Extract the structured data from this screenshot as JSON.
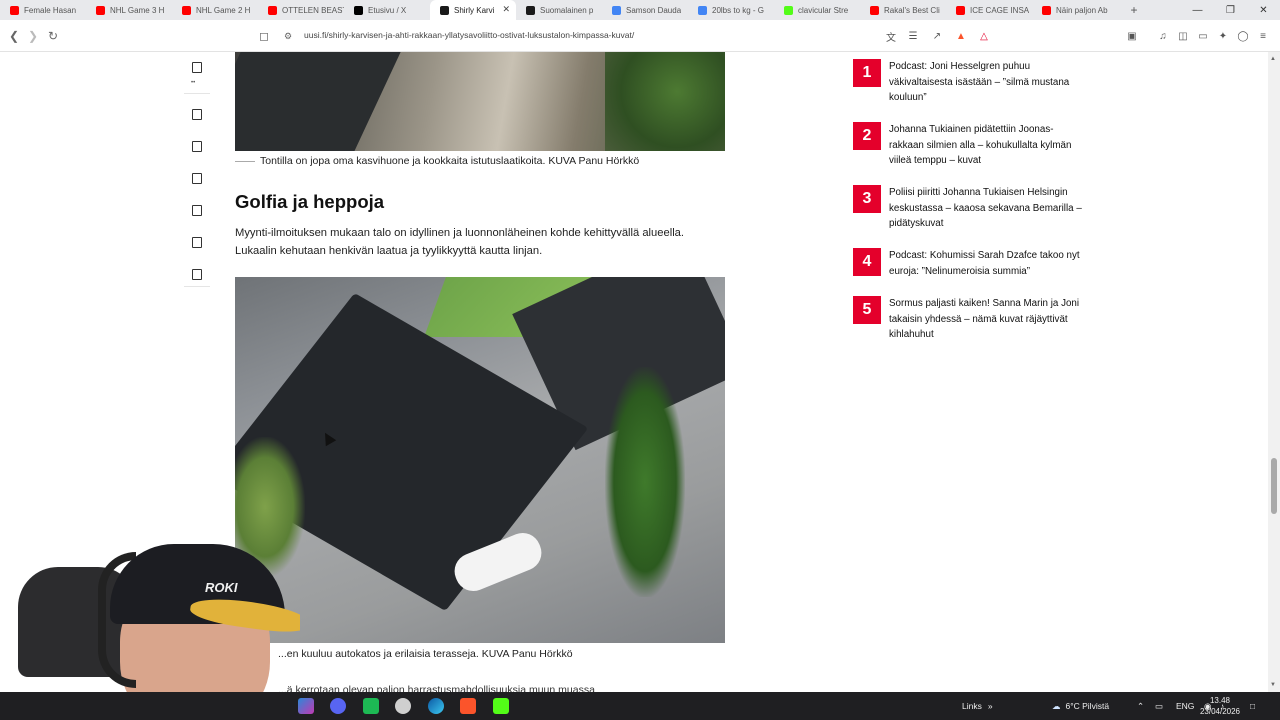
{
  "browser": {
    "tabs": [
      {
        "title": "Female Hasan",
        "color": "#ff0000"
      },
      {
        "title": "NHL Game 3 H",
        "color": "#ff0000"
      },
      {
        "title": "NHL Game 2 H",
        "color": "#ff0000"
      },
      {
        "title": "OTTELEN BEAST",
        "color": "#ff0000"
      },
      {
        "title": "Etusivu / X",
        "color": "#000000"
      },
      {
        "title": "Shirly Karvi",
        "color": "#1a1a1a",
        "active": true
      },
      {
        "title": "Suomalainen p",
        "color": "#1a1a1a"
      },
      {
        "title": "Samson Dauda",
        "color": "#4285f4"
      },
      {
        "title": "20lbs to kg - G",
        "color": "#4285f4"
      },
      {
        "title": "clavicular Stre",
        "color": "#53fc18"
      },
      {
        "title": "Rakal's Best Cli",
        "color": "#ff0000"
      },
      {
        "title": "ICE CAGE INSA",
        "color": "#ff0000"
      },
      {
        "title": "Näin paljon Ab",
        "color": "#ff0000"
      }
    ],
    "new_tab": "+",
    "url": "uusi.fi/shirly-karvisen-ja-ahti-rakkaan-yllatysavoliitto-ostivat-luksustalon-kimpassa-kuvat/"
  },
  "article": {
    "caption1": "Tontilla on jopa oma kasvihuone ja kookkaita istutuslaatikoita. KUVA Panu Hörkkö",
    "heading": "Golfia ja heppoja",
    "paragraph": "Myynti-ilmoituksen mukaan talo on idyllinen ja luonnonläheinen kohde kehittyvällä alueella. Lukaalin kehutaan henkivän laatua ja tyylikkyyttä kautta linjan.",
    "caption2": "...en kuuluu autokatos ja erilaisia terasseja. KUVA Panu Hörkkö",
    "next_text": "...ä kerrotaan olevan paljon harrastusmahdollisuuksia muun muassa"
  },
  "sidebar": {
    "items": [
      {
        "rank": "1",
        "title": "Podcast: Joni Hesselgren puhuu väkivaltaisesta isästään – ”silmä mustana kouluun”"
      },
      {
        "rank": "2",
        "title": "Johanna Tukiainen pidätettiin Joonas-rakkaan silmien alla – kohukullalta kylmän viileä temppu – kuvat"
      },
      {
        "rank": "3",
        "title": "Poliisi piiritti Johanna Tukiaisen Helsingin keskustassa – kaaosa sekavana Bemarilla – pidätyskuvat"
      },
      {
        "rank": "4",
        "title": "Podcast: Kohumissi Sarah Dzafce takoo nyt euroja: ”Nelinumeroisia summia”"
      },
      {
        "rank": "5",
        "title": "Sormus paljasti kaiken! Sanna Marin ja Joni takaisin yhdessä – nämä kuvat räjäyttivät kihlahuhut"
      }
    ]
  },
  "webcam": {
    "cap_logo": "ROKI"
  },
  "taskbar": {
    "links_label": "Links",
    "weather": "6°C  Pilvistä",
    "language": "ENG",
    "time": "13.48",
    "date": "23/04/2026"
  },
  "colors": {
    "accent_red": "#e4002b"
  }
}
